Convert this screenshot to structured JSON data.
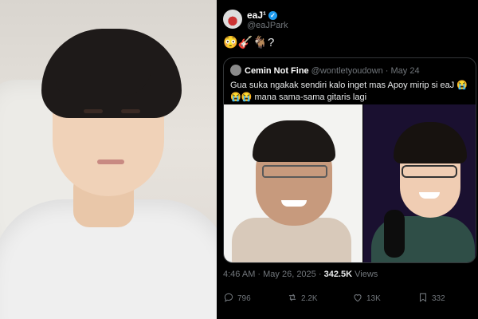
{
  "author": {
    "name": "eaJ¹",
    "handle": "@eaJPark"
  },
  "tweet": {
    "text": "😳🎸🐐?"
  },
  "quoted": {
    "name": "Cemin Not Fine",
    "handle": "@wontletyoudown",
    "date": "· May 24",
    "text": "Gua suka ngakak sendiri kalo inget mas Apoy mirip si eaJ 😭😭😭 mana sama-sama gitaris lagi"
  },
  "meta": {
    "time": "4:46 AM · May 26, 2025 · ",
    "views_count": "342.5K",
    "views_label": " Views"
  },
  "actions": {
    "replies": "796",
    "reposts": "2.2K",
    "likes": "13K",
    "bookmarks": "332"
  },
  "colors": {
    "background": "#000000",
    "verified": "#1d9bf0",
    "muted": "#71767b"
  }
}
